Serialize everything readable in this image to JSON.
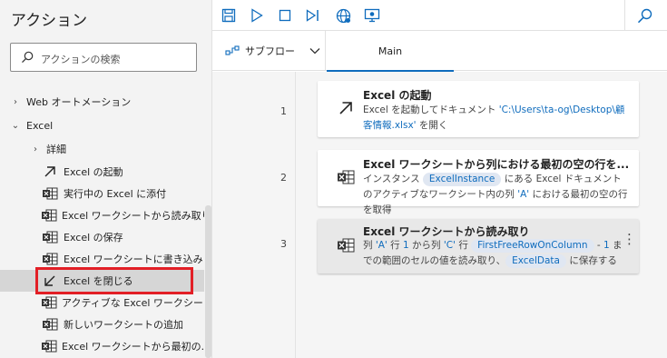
{
  "sidebar": {
    "title": "アクション",
    "search_placeholder": "アクションの検索",
    "items": [
      {
        "label": "Web オートメーション",
        "chevron": "›",
        "icon": "",
        "level": 0
      },
      {
        "label": "Excel",
        "chevron": "⌄",
        "icon": "",
        "level": 0
      },
      {
        "label": "詳細",
        "chevron": "›",
        "icon": "",
        "level": 1
      },
      {
        "label": "Excel の起動",
        "chevron": "",
        "icon": "arrow-up-right-icon",
        "level": 2
      },
      {
        "label": "実行中の Excel に添付",
        "chevron": "",
        "icon": "excel-icon",
        "level": 2
      },
      {
        "label": "Excel ワークシートから読み取り",
        "chevron": "",
        "icon": "excel-icon",
        "level": 2
      },
      {
        "label": "Excel の保存",
        "chevron": "",
        "icon": "excel-icon",
        "level": 2
      },
      {
        "label": "Excel ワークシートに書き込み",
        "chevron": "",
        "icon": "excel-icon",
        "level": 2
      },
      {
        "label": "Excel を閉じる",
        "chevron": "",
        "icon": "arrow-down-left-icon",
        "level": 2
      },
      {
        "label": "アクティブな Excel ワークシー...",
        "chevron": "",
        "icon": "excel-icon",
        "level": 2
      },
      {
        "label": "新しいワークシートの追加",
        "chevron": "",
        "icon": "excel-icon",
        "level": 2
      },
      {
        "label": "Excel ワークシートから最初の...",
        "chevron": "",
        "icon": "excel-icon",
        "level": 2
      }
    ]
  },
  "toolbar": {
    "icons": [
      "save-icon",
      "run-icon",
      "stop-icon",
      "step-icon",
      "web-recorder-icon",
      "desktop-recorder-icon",
      "search-icon"
    ]
  },
  "tabs": {
    "subflow_label": "サブフロー",
    "main_label": "Main"
  },
  "flow": {
    "steps": [
      {
        "line": "1",
        "title": "Excel の起動",
        "icon": "arrow-up-right-icon",
        "desc_pre": "Excel を起動してドキュメント ",
        "desc_lit": "'C:\\Users\\ta-og\\Desktop\\顧客情報.xlsx'",
        "desc_post": " を開く"
      },
      {
        "line": "2",
        "title": "Excel ワークシートから列における最初の空の行を...",
        "icon": "excel-icon",
        "desc_a": "インスタンス ",
        "desc_var": "ExcelInstance",
        "desc_b": " にある Excel ドキュメントのアクティブなワークシート内の列 ",
        "desc_lit": "'A'",
        "desc_c": " における最初の空の行を取得"
      },
      {
        "line": "3",
        "title": "Excel ワークシートから読み取り",
        "icon": "excel-icon",
        "desc_a": "列 ",
        "desc_lit1": "'A'",
        "desc_b": " 行 ",
        "desc_lit2": "1",
        "desc_c": " から列 ",
        "desc_lit3": "'C'",
        "desc_d": " 行 ",
        "desc_var1": "FirstFreeRowOnColumn",
        "desc_e": " - ",
        "desc_lit4": "1",
        "desc_f": " までの範囲のセルの値を読み取り、",
        "desc_var2": "ExcelData",
        "desc_g": " に保存する",
        "more": "⋮"
      }
    ]
  },
  "colors": {
    "accent": "#0f6cbd",
    "selection_outline": "#e21f26",
    "excel_green": "#1d6f42"
  }
}
